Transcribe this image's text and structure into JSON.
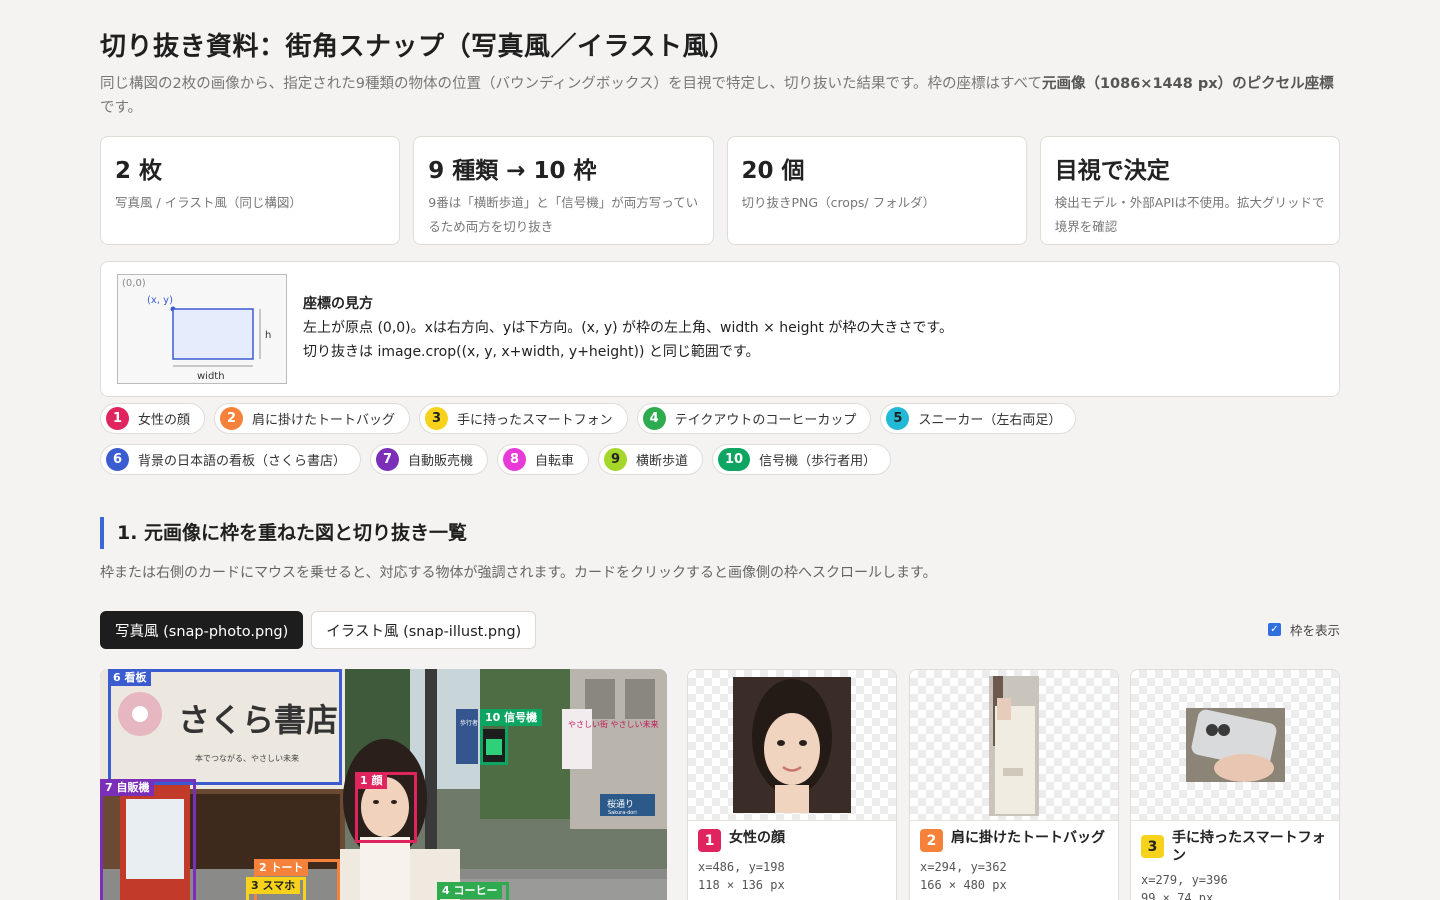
{
  "page": {
    "title": "切り抜き資料：街角スナップ（写真風／イラスト風）",
    "intro_text": "同じ構図の2枚の画像から、指定された9種類の物体の位置（バウンディングボックス）を目視で特定し、切り抜いた結果です。枠の座標はすべて",
    "intro_bold": "元画像（1086×1448 px）のピクセル座標",
    "intro_tail": "です。"
  },
  "stats": [
    {
      "big": "2 枚",
      "small": "写真風 / イラスト風（同じ構図）"
    },
    {
      "big": "9 種類 → 10 枠",
      "small": "9番は「横断歩道」と「信号機」が両方写っているため両方を切り抜き"
    },
    {
      "big": "20 個",
      "small": "切り抜きPNG（crops/ フォルダ）"
    },
    {
      "big": "目視で決定",
      "small": "検出モデル・外部APIは不使用。拡大グリッドで境界を確認"
    }
  ],
  "coord_box": {
    "origin": "(0,0)",
    "corner": "(x, y)",
    "width_label": "width",
    "height_label": "h",
    "heading": "座標の見方",
    "line1": "左上が原点 (0,0)。xは右方向、yは下方向。(x, y) が枠の左上角、width × height が枠の大きさです。",
    "line2": "切り抜きは image.crop((x, y, x+width, y+height)) と同じ範囲です。"
  },
  "legend": [
    {
      "num": "1",
      "label": "女性の顔",
      "color": "#e0245e"
    },
    {
      "num": "2",
      "label": "肩に掛けたトートバッグ",
      "color": "#f5813b"
    },
    {
      "num": "3",
      "label": "手に持ったスマートフォン",
      "color": "#f7d21b"
    },
    {
      "num": "4",
      "label": "テイクアウトのコーヒーカップ",
      "color": "#2eaa4f"
    },
    {
      "num": "5",
      "label": "スニーカー（左右両足）",
      "color": "#22b9d6"
    },
    {
      "num": "6",
      "label": "背景の日本語の看板（さくら書店）",
      "color": "#3b5bd1"
    },
    {
      "num": "7",
      "label": "自動販売機",
      "color": "#7b2fb8"
    },
    {
      "num": "8",
      "label": "自転車",
      "color": "#e83ad8"
    },
    {
      "num": "9",
      "label": "横断歩道",
      "color": "#a5d62a"
    },
    {
      "num": "10",
      "label": "信号機（歩行者用）",
      "color": "#0ea462"
    }
  ],
  "section1": {
    "heading": "1. 元画像に枠を重ねた図と切り抜き一覧",
    "desc": "枠または右側のカードにマウスを乗せると、対応する物体が強調されます。カードをクリックすると画像側の枠へスクロールします。"
  },
  "tabs": [
    {
      "label": "写真風 (snap-photo.png)",
      "active": true
    },
    {
      "label": "イラスト風 (snap-illust.png)",
      "active": false
    }
  ],
  "toggle": {
    "label": "枠を表示",
    "checked": true
  },
  "photo_scene": {
    "shop_sign": "さくら書店",
    "shop_sub": "本でつながる、やさしい未来",
    "banner": "やさしい街 やさしい未来",
    "street_sign": "桜通り",
    "street_sign_sub": "Sakura-dori",
    "small_sign": "歩行者 自転車 専用"
  },
  "photo_tags": [
    {
      "text": "6 看板",
      "color": "#3b5bd1"
    },
    {
      "text": "7 自販機",
      "color": "#7b2fb8"
    },
    {
      "text": "1 顔",
      "color": "#e0245e"
    },
    {
      "text": "10 信号機",
      "color": "#0ea462"
    },
    {
      "text": "2 トート",
      "color": "#f5813b"
    },
    {
      "text": "3 スマホ",
      "color": "#f7d21b"
    },
    {
      "text": "4 コーヒー",
      "color": "#2eaa4f"
    }
  ],
  "cards": [
    {
      "num": "1",
      "color": "#e0245e",
      "name": "女性の顔",
      "xy": "x=486, y=198",
      "size": "118 × 136 px"
    },
    {
      "num": "2",
      "color": "#f5813b",
      "name": "肩に掛けたトートバッグ",
      "xy": "x=294, y=362",
      "size": "166 × 480 px"
    },
    {
      "num": "3",
      "color": "#f7d21b",
      "name": "手に持ったスマートフォン",
      "xy": "x=279, y=396",
      "size": "99 × 74 px"
    }
  ]
}
